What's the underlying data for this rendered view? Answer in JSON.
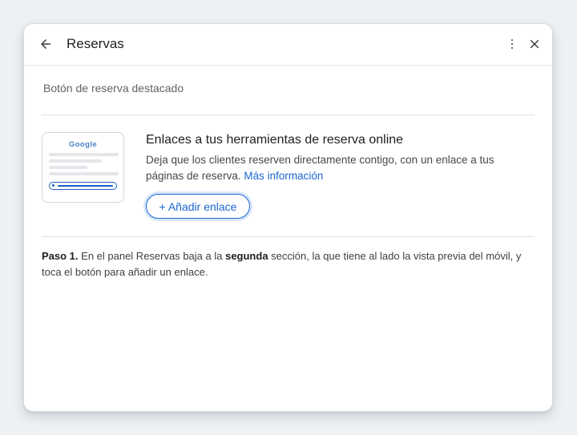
{
  "header": {
    "title": "Reservas",
    "back_icon": "arrow-back-icon",
    "more_icon": "more-vert-icon",
    "close_icon": "close-icon"
  },
  "section": {
    "title": "Botón de reserva destacado"
  },
  "preview": {
    "brand": "Google"
  },
  "card": {
    "heading": "Enlaces a tus herramientas de reserva online",
    "description": "Deja que los clientes reserven directamente contigo, con un enlace a tus páginas de reserva.",
    "link_label": "Más información",
    "add_button_label": "+ Añadir enlace"
  },
  "step": {
    "number": "Paso 1.",
    "text_1": " En el panel Reservas baja a la ",
    "bold": "segunda",
    "text_2": " sección, la que tiene al lado la vista previa del móvil, y toca el botón para añadir un enlace."
  },
  "colors": {
    "accent": "#1a66d2",
    "background": "#eef1f4",
    "panel": "#ffffff"
  }
}
